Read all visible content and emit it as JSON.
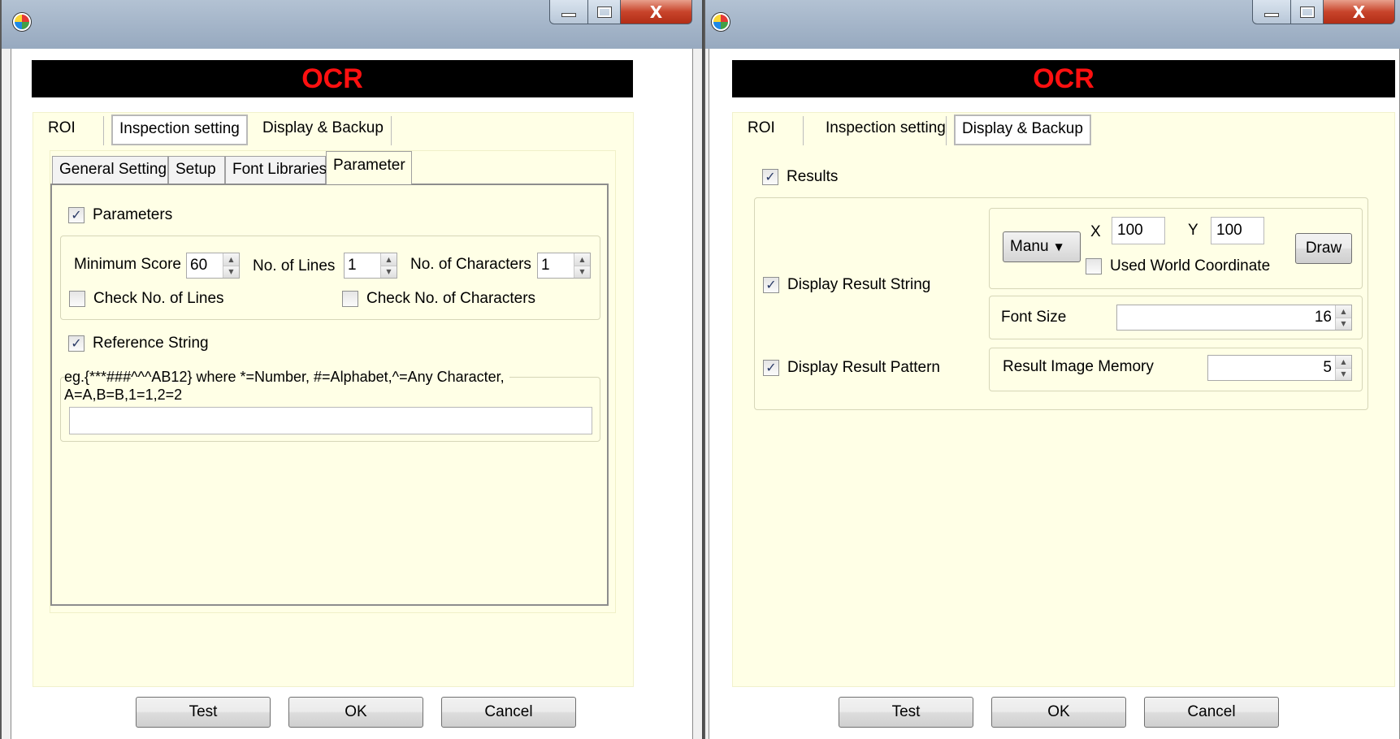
{
  "banner_title": "OCR",
  "colors": {
    "banner_bg": "#000000",
    "banner_text": "#ff1010",
    "panel_bg": "#ffffe6"
  },
  "icons": [
    "app-icon",
    "minimize-icon",
    "maximize-icon",
    "close-icon",
    "checkmark-icon",
    "spin-up-icon",
    "spin-down-icon",
    "dropdown-caret-icon"
  ],
  "window_controls": {
    "close_label": "X"
  },
  "main_tabs": [
    {
      "label": "ROI"
    },
    {
      "label": "Inspection setting"
    },
    {
      "label": "Display & Backup"
    }
  ],
  "left": {
    "active_main_tab": "Inspection setting",
    "sub_tabs": [
      {
        "label": "General Setting"
      },
      {
        "label": "Setup"
      },
      {
        "label": "Font Libraries"
      },
      {
        "label": "Parameter"
      }
    ],
    "active_sub_tab": "Parameter",
    "parameters": {
      "label": "Parameters",
      "checked": true,
      "min_score_label": "Minimum Score",
      "min_score_value": "60",
      "lines_label": "No. of Lines",
      "lines_value": "1",
      "chars_label": "No. of Characters",
      "chars_value": "1",
      "check_lines_label": "Check No. of Lines",
      "check_lines_checked": false,
      "check_chars_label": "Check No. of Characters",
      "check_chars_checked": false
    },
    "reference": {
      "label": "Reference String",
      "checked": true,
      "hint_line1": "eg.{***###^^^AB12} where *=Number, #=Alphabet,^=Any Character,",
      "hint_line2": "A=A,B=B,1=1,2=2",
      "value": ""
    }
  },
  "right": {
    "active_main_tab": "Display & Backup",
    "results": {
      "label": "Results",
      "checked": true
    },
    "display_string": {
      "label": "Display Result String",
      "checked": true
    },
    "position_mode": "Manu",
    "x_label": "X",
    "x_value": "100",
    "y_label": "Y",
    "y_value": "100",
    "draw_label": "Draw",
    "world_coord": {
      "label": "Used World Coordinate",
      "checked": false
    },
    "font_size_label": "Font Size",
    "font_size_value": "16",
    "display_pattern": {
      "label": "Display Result Pattern",
      "checked": true
    },
    "memory_label": "Result Image Memory",
    "memory_value": "5"
  },
  "footer": {
    "test_label": "Test",
    "ok_label": "OK",
    "cancel_label": "Cancel"
  }
}
